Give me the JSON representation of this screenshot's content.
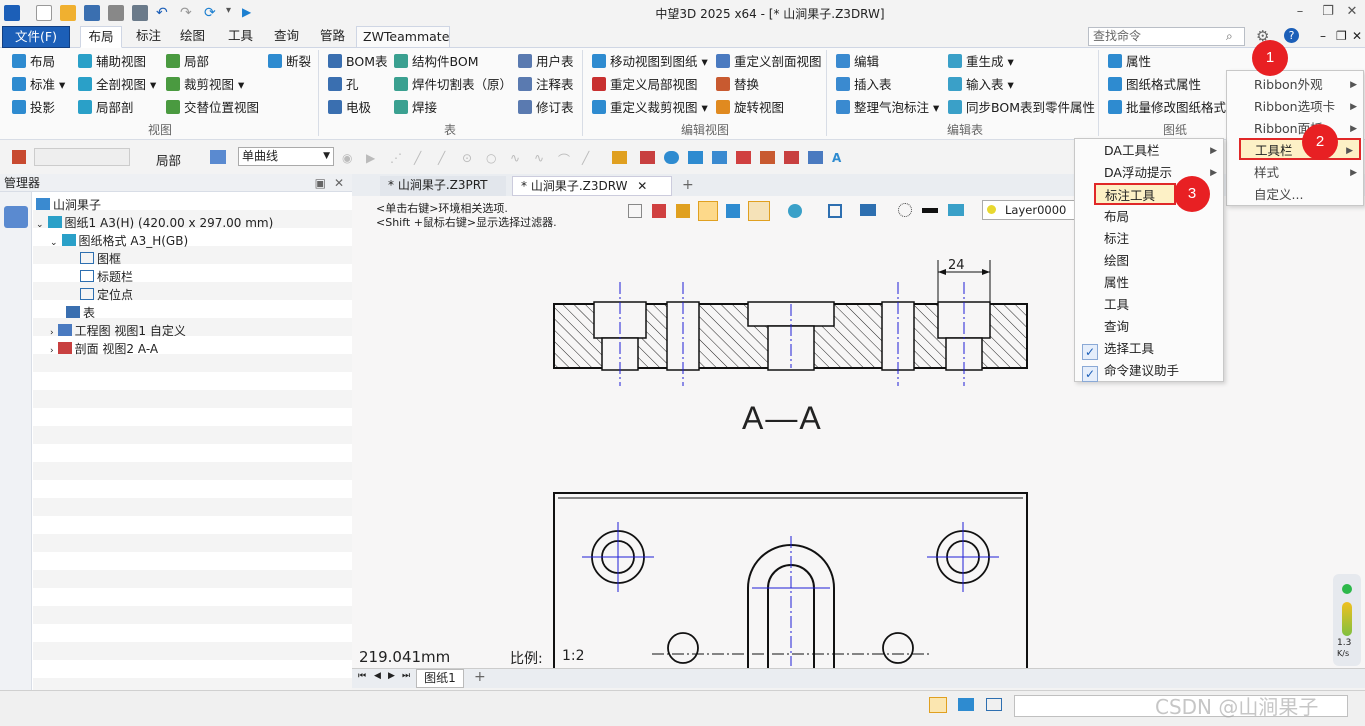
{
  "window": {
    "title": "中望3D 2025 x64 - [* 山涧果子.Z3DRW]"
  },
  "menu_tabs": [
    "文件(F)",
    "布局",
    "标注",
    "绘图",
    "工具",
    "查询",
    "管路",
    "ZWTeammate"
  ],
  "command_search": {
    "placeholder": "查找命令"
  },
  "ribbon": {
    "view": {
      "label": "视图",
      "items": [
        "布局",
        "标准",
        "投影",
        "辅助视图",
        "全剖视图",
        "局部剖",
        "局部",
        "裁剪视图",
        "交替位置视图",
        "断裂"
      ]
    },
    "table": {
      "label": "表",
      "items": [
        "BOM表",
        "孔",
        "电极",
        "结构件BOM",
        "焊件切割表（原）",
        "焊接",
        "用户表",
        "注释表",
        "修订表"
      ]
    },
    "edit_view": {
      "label": "编辑视图",
      "items": [
        "移动视图到图纸",
        "重定义局部视图",
        "重定义裁剪视图",
        "重定义剖面视图",
        "替换",
        "旋转视图"
      ]
    },
    "edit_table": {
      "label": "编辑表",
      "items": [
        "编辑",
        "插入表",
        "整理气泡标注",
        "重生成",
        "输入表",
        "同步BOM表到零件属性"
      ]
    },
    "sheet": {
      "label": "图纸",
      "items": [
        "属性",
        "图纸格式属性",
        "批量修改图纸格式"
      ]
    }
  },
  "toolbar": {
    "local_label": "局部",
    "curve_select": "单曲线"
  },
  "manager": {
    "title": "管理器",
    "tree": [
      {
        "label": "山涧果子"
      },
      {
        "label": "图纸1 A3(H) (420.00 x 297.00 mm)"
      },
      {
        "label": "图纸格式 A3_H(GB)"
      },
      {
        "label": "图框"
      },
      {
        "label": "标题栏"
      },
      {
        "label": "定位点"
      },
      {
        "label": "表"
      },
      {
        "label": "工程图 视图1 自定义"
      },
      {
        "label": "剖面 视图2 A-A"
      }
    ]
  },
  "doc_tabs": [
    {
      "label": "* 山涧果子.Z3PRT"
    },
    {
      "label": "* 山涧果子.Z3DRW"
    }
  ],
  "canvas": {
    "hint1": "<单击右键>环境相关选项.",
    "hint2": "<Shift +鼠标右键>显示选择过滤器.",
    "dimension": "24",
    "section_label": "A—A",
    "measure": "219.041mm",
    "scale_label": "比例:",
    "scale_value": "1:2",
    "layer": "Layer0000"
  },
  "sheet_tabs": [
    "图纸1"
  ],
  "context_menu_1": {
    "items": [
      "Ribbon外观",
      "Ribbon选项卡",
      "Ribbon面板",
      "工具栏",
      "样式",
      "自定义..."
    ]
  },
  "context_menu_2": {
    "items": [
      "DA工具栏",
      "DA浮动提示",
      "标注工具",
      "布局",
      "标注",
      "绘图",
      "属性",
      "工具",
      "查询",
      "选择工具",
      "命令建议助手"
    ]
  },
  "badges": [
    "1",
    "2",
    "3"
  ],
  "speed": {
    "value": "1.3",
    "unit": "K/s"
  },
  "watermark": "CSDN @山涧果子",
  "colors": {
    "accent": "#1c5fb8",
    "badge": "#e82023",
    "highlight": "#fdf1c6",
    "centerline": "#1f1fd6"
  }
}
